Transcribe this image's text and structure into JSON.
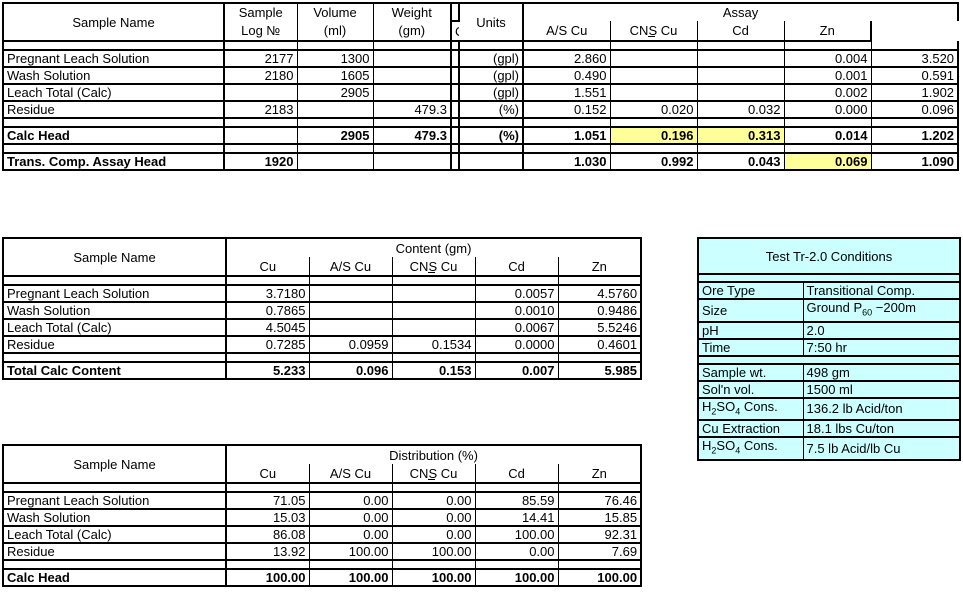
{
  "table1": {
    "headers": {
      "sample_name": "Sample Name",
      "sample_log_l1": "Sample",
      "sample_log_l2": "Log №",
      "volume_l1": "Volume",
      "volume_l2": "(ml)",
      "weight_l1": "Weight",
      "weight_l2": "(gm)",
      "units": "Units",
      "assay_group": "Assay",
      "cu": "Cu",
      "as_cu": "A/S Cu",
      "cns_cu_pre": "CN",
      "cns_cu_post": "S Cu",
      "cd": "Cd",
      "zn": "Zn"
    },
    "rows": [
      {
        "name": "Pregnant Leach Solution",
        "log": "2177",
        "volume": "1300",
        "weight": "",
        "units": "(gpl)",
        "cu": "2.860",
        "as_cu": "",
        "cns_cu": "",
        "cd": "0.004",
        "zn": "3.520",
        "bold": false,
        "sep_above": false,
        "hl": {
          "cu": false,
          "as_cu": false,
          "cns_cu": false,
          "cd": false,
          "zn": false
        }
      },
      {
        "name": "Wash Solution",
        "log": "2180",
        "volume": "1605",
        "weight": "",
        "units": "(gpl)",
        "cu": "0.490",
        "as_cu": "",
        "cns_cu": "",
        "cd": "0.001",
        "zn": "0.591",
        "bold": false,
        "sep_above": false,
        "hl": {
          "cu": false,
          "as_cu": false,
          "cns_cu": false,
          "cd": false,
          "zn": false
        }
      },
      {
        "name": "Leach Total (Calc)",
        "log": "",
        "volume": "2905",
        "weight": "",
        "units": "(gpl)",
        "cu": "1.551",
        "as_cu": "",
        "cns_cu": "",
        "cd": "0.002",
        "zn": "1.902",
        "bold": false,
        "sep_above": false,
        "hl": {
          "cu": false,
          "as_cu": false,
          "cns_cu": false,
          "cd": false,
          "zn": false
        }
      },
      {
        "name": "Residue",
        "log": "2183",
        "volume": "",
        "weight": "479.3",
        "units": "(%)",
        "cu": "0.152",
        "as_cu": "0.020",
        "cns_cu": "0.032",
        "cd": "0.000",
        "zn": "0.096",
        "bold": false,
        "sep_above": false,
        "hl": {
          "cu": false,
          "as_cu": false,
          "cns_cu": false,
          "cd": false,
          "zn": false
        }
      },
      {
        "name": "Calc Head",
        "log": "",
        "volume": "2905",
        "weight": "479.3",
        "units": "(%)",
        "cu": "1.051",
        "as_cu": "0.196",
        "cns_cu": "0.313",
        "cd": "0.014",
        "zn": "1.202",
        "bold": true,
        "sep_above": true,
        "hl": {
          "cu": false,
          "as_cu": true,
          "cns_cu": true,
          "cd": false,
          "zn": false
        }
      },
      {
        "name": "Trans. Comp. Assay Head",
        "log": "1920",
        "volume": "",
        "weight": "",
        "units": "",
        "cu": "1.030",
        "as_cu": "0.992",
        "cns_cu": "0.043",
        "cd": "0.069",
        "zn": "1.090",
        "bold": true,
        "sep_above": true,
        "hl": {
          "cu": false,
          "as_cu": false,
          "cns_cu": false,
          "cd": true,
          "zn": false
        }
      }
    ]
  },
  "table2": {
    "headers": {
      "sample_name": "Sample Name",
      "group": "Content (gm)",
      "cu": "Cu",
      "as_cu": "A/S Cu",
      "cns_cu_pre": "CN",
      "cns_cu_post": "S Cu",
      "cd": "Cd",
      "zn": "Zn"
    },
    "rows": [
      {
        "name": "Pregnant Leach Solution",
        "cu": "3.7180",
        "as_cu": "",
        "cns_cu": "",
        "cd": "0.0057",
        "zn": "4.5760",
        "bold": false,
        "sep_above": false
      },
      {
        "name": "Wash Solution",
        "cu": "0.7865",
        "as_cu": "",
        "cns_cu": "",
        "cd": "0.0010",
        "zn": "0.9486",
        "bold": false,
        "sep_above": false
      },
      {
        "name": "Leach Total (Calc)",
        "cu": "4.5045",
        "as_cu": "",
        "cns_cu": "",
        "cd": "0.0067",
        "zn": "5.5246",
        "bold": false,
        "sep_above": false
      },
      {
        "name": "Residue",
        "cu": "0.7285",
        "as_cu": "0.0959",
        "cns_cu": "0.1534",
        "cd": "0.0000",
        "zn": "0.4601",
        "bold": false,
        "sep_above": false
      },
      {
        "name": "Total Calc Content",
        "cu": "5.233",
        "as_cu": "0.096",
        "cns_cu": "0.153",
        "cd": "0.007",
        "zn": "5.985",
        "bold": true,
        "sep_above": true
      }
    ]
  },
  "table3": {
    "headers": {
      "sample_name": "Sample Name",
      "group": "Distribution (%)",
      "cu": "Cu",
      "as_cu": "A/S Cu",
      "cns_cu_pre": "CN",
      "cns_cu_post": "S Cu",
      "cd": "Cd",
      "zn": "Zn"
    },
    "rows": [
      {
        "name": "Pregnant Leach Solution",
        "cu": "71.05",
        "as_cu": "0.00",
        "cns_cu": "0.00",
        "cd": "85.59",
        "zn": "76.46",
        "bold": false,
        "sep_above": false
      },
      {
        "name": "Wash Solution",
        "cu": "15.03",
        "as_cu": "0.00",
        "cns_cu": "0.00",
        "cd": "14.41",
        "zn": "15.85",
        "bold": false,
        "sep_above": false
      },
      {
        "name": "Leach Total (Calc)",
        "cu": "86.08",
        "as_cu": "0.00",
        "cns_cu": "0.00",
        "cd": "100.00",
        "zn": "92.31",
        "bold": false,
        "sep_above": false
      },
      {
        "name": "Residue",
        "cu": "13.92",
        "as_cu": "100.00",
        "cns_cu": "100.00",
        "cd": "0.00",
        "zn": "7.69",
        "bold": false,
        "sep_above": false
      },
      {
        "name": "Calc Head",
        "cu": "100.00",
        "as_cu": "100.00",
        "cns_cu": "100.00",
        "cd": "100.00",
        "zn": "100.00",
        "bold": true,
        "sep_above": true
      }
    ]
  },
  "conditions": {
    "title": "Test Tr-2.0 Conditions",
    "group1": [
      {
        "label": "Ore Type",
        "value": "Transitional Comp."
      },
      {
        "label": "Size",
        "value_pre": "Ground P",
        "value_sub": "60",
        "value_post": " −200m"
      },
      {
        "label": "pH",
        "value": "2.0"
      },
      {
        "label": "Time",
        "value": "7:50 hr"
      }
    ],
    "group2": [
      {
        "label": "Sample wt.",
        "value": "498 gm"
      },
      {
        "label": "Sol'n vol.",
        "value": "1500 ml"
      },
      {
        "label_pre": "H",
        "label_sub": "2",
        "label_mid": "SO",
        "label_sub2": "4",
        "label_post": " Cons.",
        "value": "136.2 lb Acid/ton"
      },
      {
        "label": "Cu Extraction",
        "value": "18.1 lbs Cu/ton"
      },
      {
        "label_pre": "H",
        "label_sub": "2",
        "label_mid": "SO",
        "label_sub2": "4",
        "label_post": " Cons.",
        "value": "7.5 lb Acid/lb Cu"
      }
    ]
  },
  "colors": {
    "highlight": "#ffff99",
    "panel": "#ccffff",
    "grid": "#000000",
    "background": "#ffffff"
  }
}
